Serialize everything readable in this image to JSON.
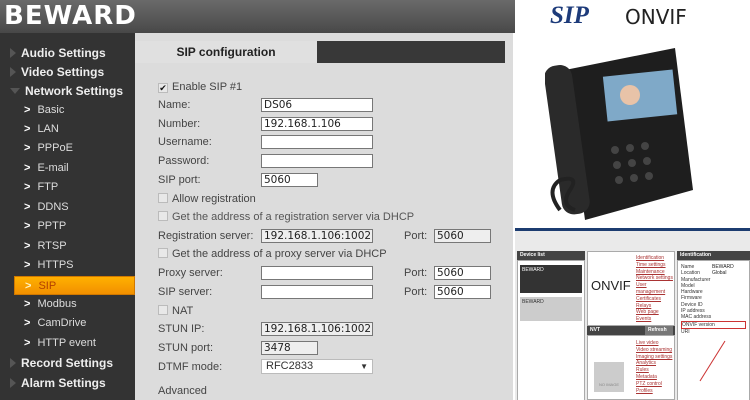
{
  "header": {
    "logo": "BEWARD"
  },
  "sidebar": {
    "sections": [
      {
        "label": "Audio Settings",
        "state": "collapsed"
      },
      {
        "label": "Video Settings",
        "state": "collapsed"
      },
      {
        "label": "Network Settings",
        "state": "expanded"
      },
      {
        "label": "Record Settings",
        "state": "collapsed"
      },
      {
        "label": "Alarm Settings",
        "state": "collapsed"
      }
    ],
    "network_items": [
      "Basic",
      "LAN",
      "PPPoE",
      "E-mail",
      "FTP",
      "DDNS",
      "PPTP",
      "RTSP",
      "HTTPS",
      "SIP",
      "Modbus",
      "CamDrive",
      "HTTP event"
    ],
    "active": "SIP"
  },
  "form": {
    "tab": "SIP configuration",
    "enable_sip": {
      "label": "Enable SIP #1",
      "checked": true
    },
    "name": {
      "label": "Name:",
      "value": "DS06"
    },
    "number": {
      "label": "Number:",
      "value": "192.168.1.106"
    },
    "username": {
      "label": "Username:",
      "value": ""
    },
    "password": {
      "label": "Password:",
      "value": ""
    },
    "sip_port": {
      "label": "SIP port:",
      "value": "5060"
    },
    "allow_registration": {
      "label": "Allow registration",
      "checked": false
    },
    "reg_dhcp": {
      "label": "Get the address of a registration server via DHCP",
      "checked": false
    },
    "registration_server": {
      "label": "Registration server:",
      "value": "192.168.1.106:1002",
      "port_label": "Port:",
      "port": "5060"
    },
    "proxy_dhcp": {
      "label": "Get the address of a proxy server via DHCP",
      "checked": false
    },
    "proxy_server": {
      "label": "Proxy server:",
      "value": "",
      "port_label": "Port:",
      "port": "5060"
    },
    "sip_server": {
      "label": "SIP server:",
      "value": "",
      "port_label": "Port:",
      "port": "5060"
    },
    "nat": {
      "label": "NAT",
      "checked": false
    },
    "stun_ip": {
      "label": "STUN IP:",
      "value": "192.168.1.106:1002"
    },
    "stun_port": {
      "label": "STUN port:",
      "value": "3478"
    },
    "dtmf": {
      "label": "DTMF mode:",
      "value": "RFC2833"
    },
    "advanced": "Advanced"
  },
  "right": {
    "sip_logo": "SIP",
    "onvif_logo": "ONVIF",
    "onvif_tool": {
      "device_list": "Device list",
      "beward1": "BEWARD",
      "beward2": "BEWARD",
      "nvt": "NVT",
      "refresh": "Refresh",
      "identification": "Identification",
      "links": [
        "Identification",
        "Time settings",
        "Maintenance",
        "Network settings",
        "User management",
        "Certificates",
        "Relays",
        "Web page",
        "Events"
      ],
      "links2": [
        "Live video",
        "Video streaming",
        "Imaging settings",
        "Analytics",
        "Rules",
        "Metadata",
        "PTZ control",
        "Profiles"
      ],
      "id_fields": [
        "Name",
        "Location",
        "Manufacturer",
        "Model",
        "Hardware",
        "Firmware",
        "Device ID",
        "IP address",
        "MAC address",
        "ONVIF version",
        "URI"
      ],
      "name_value": "BEWARD",
      "location_value": "Global",
      "no_image": "NO IMAGE"
    }
  }
}
